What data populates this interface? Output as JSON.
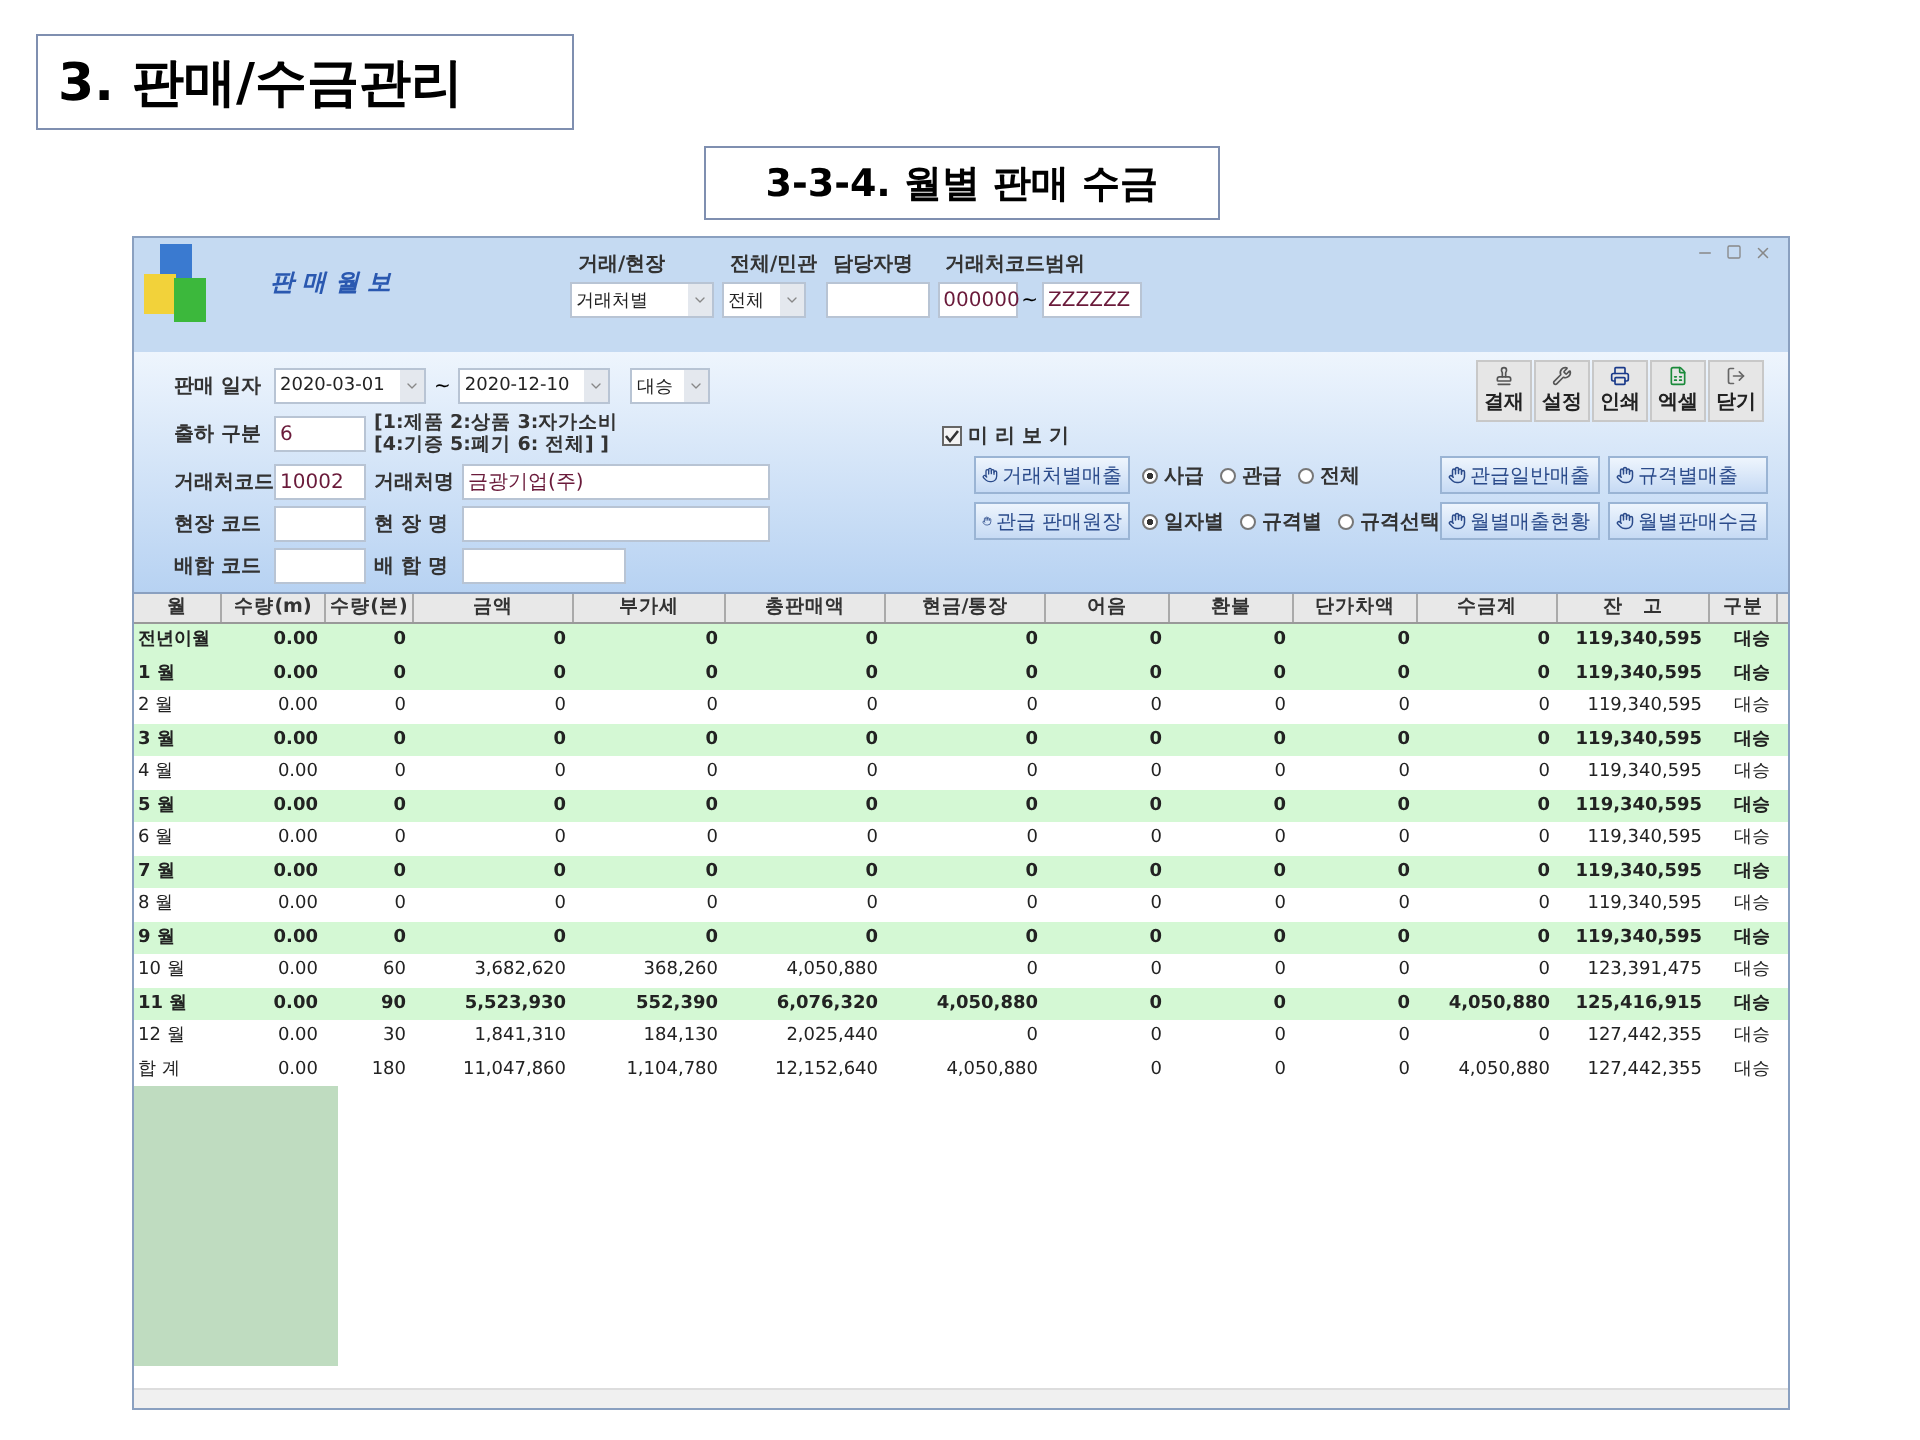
{
  "slide_title": "3. 판매/수금관리",
  "section_title": "3-3-4. 월별 판매 수금",
  "window": {
    "title": "판 매 월 보",
    "filters": [
      {
        "kind": "select",
        "label": "거래/현장",
        "value": "거래처별"
      },
      {
        "kind": "select",
        "label": "전체/민관",
        "value": "전체"
      },
      {
        "kind": "text",
        "label": "담당자명"
      },
      {
        "kind": "range",
        "label": "거래처코드범위",
        "from": "000000",
        "sep": "~",
        "to": "ZZZZZZ"
      }
    ],
    "sale_date": {
      "label": "판매 일자",
      "from": "2020-03-01",
      "sep": "~",
      "to": "2020-12-10",
      "type": "대승"
    },
    "shipment": {
      "label": "출하 구분",
      "value": "6",
      "hint": [
        "[1:제품 2:상품 3:자가소비",
        "[4:기증 5:폐기 6: 전체] ]"
      ]
    },
    "fields": [
      {
        "code_label": "거래처코드",
        "code": "10002",
        "name_label": "거래처명",
        "name": "금광기업(주)"
      },
      {
        "code_label": "현장 코드",
        "name_label": "현 장 명"
      },
      {
        "code_label": "배합 코드",
        "name_label": "배 합 명"
      }
    ],
    "toolbar": [
      {
        "kind": "approve",
        "label": "결재"
      },
      {
        "kind": "settings",
        "label": "설정"
      },
      {
        "kind": "print",
        "label": "인쇄"
      },
      {
        "kind": "excel",
        "label": "엑셀"
      },
      {
        "kind": "exit",
        "label": "닫기"
      }
    ],
    "preview": {
      "label": "미 리 보 기",
      "checked": true
    },
    "report_buttons_left": [
      "거래처별매출",
      "관급 판매원장"
    ],
    "radio_groups": [
      [
        {
          "label": "사급",
          "selected": true
        },
        {
          "label": "관급",
          "selected": false
        },
        {
          "label": "전체",
          "selected": false
        }
      ],
      [
        {
          "label": "일자별",
          "selected": true
        },
        {
          "label": "규격별",
          "selected": false
        },
        {
          "label": "규격선택",
          "selected": false
        }
      ]
    ],
    "report_buttons_right": [
      "관급일반매출",
      "규격별매출",
      "월별매출현황",
      "월별판매수금"
    ],
    "table": {
      "columns": [
        "월",
        "수량(m)",
        "수량(본)",
        "금액",
        "부가세",
        "총판매액",
        "현금/통장",
        "어음",
        "환불",
        "단가차액",
        "수금계",
        "잔　고",
        "구분"
      ],
      "rows": [
        {
          "highlighted": true,
          "cells": [
            "전년이월",
            "0.00",
            "0",
            "0",
            "0",
            "0",
            "0",
            "0",
            "0",
            "0",
            "0",
            "119,340,595",
            "대승"
          ]
        },
        {
          "highlighted": true,
          "cells": [
            "1 월",
            "0.00",
            "0",
            "0",
            "0",
            "0",
            "0",
            "0",
            "0",
            "0",
            "0",
            "119,340,595",
            "대승"
          ]
        },
        {
          "highlighted": false,
          "cells": [
            "2 월",
            "0.00",
            "0",
            "0",
            "0",
            "0",
            "0",
            "0",
            "0",
            "0",
            "0",
            "119,340,595",
            "대승"
          ]
        },
        {
          "highlighted": true,
          "cells": [
            "3 월",
            "0.00",
            "0",
            "0",
            "0",
            "0",
            "0",
            "0",
            "0",
            "0",
            "0",
            "119,340,595",
            "대승"
          ]
        },
        {
          "highlighted": false,
          "cells": [
            "4 월",
            "0.00",
            "0",
            "0",
            "0",
            "0",
            "0",
            "0",
            "0",
            "0",
            "0",
            "119,340,595",
            "대승"
          ]
        },
        {
          "highlighted": true,
          "cells": [
            "5 월",
            "0.00",
            "0",
            "0",
            "0",
            "0",
            "0",
            "0",
            "0",
            "0",
            "0",
            "119,340,595",
            "대승"
          ]
        },
        {
          "highlighted": false,
          "cells": [
            "6 월",
            "0.00",
            "0",
            "0",
            "0",
            "0",
            "0",
            "0",
            "0",
            "0",
            "0",
            "119,340,595",
            "대승"
          ]
        },
        {
          "highlighted": true,
          "cells": [
            "7 월",
            "0.00",
            "0",
            "0",
            "0",
            "0",
            "0",
            "0",
            "0",
            "0",
            "0",
            "119,340,595",
            "대승"
          ]
        },
        {
          "highlighted": false,
          "cells": [
            "8 월",
            "0.00",
            "0",
            "0",
            "0",
            "0",
            "0",
            "0",
            "0",
            "0",
            "0",
            "119,340,595",
            "대승"
          ]
        },
        {
          "highlighted": true,
          "cells": [
            "9 월",
            "0.00",
            "0",
            "0",
            "0",
            "0",
            "0",
            "0",
            "0",
            "0",
            "0",
            "119,340,595",
            "대승"
          ]
        },
        {
          "highlighted": false,
          "cells": [
            "10 월",
            "0.00",
            "60",
            "3,682,620",
            "368,260",
            "4,050,880",
            "0",
            "0",
            "0",
            "0",
            "0",
            "123,391,475",
            "대승"
          ]
        },
        {
          "highlighted": true,
          "cells": [
            "11 월",
            "0.00",
            "90",
            "5,523,930",
            "552,390",
            "6,076,320",
            "4,050,880",
            "0",
            "0",
            "0",
            "4,050,880",
            "125,416,915",
            "대승"
          ]
        },
        {
          "highlighted": false,
          "cells": [
            "12 월",
            "0.00",
            "30",
            "1,841,310",
            "184,130",
            "2,025,440",
            "0",
            "0",
            "0",
            "0",
            "0",
            "127,442,355",
            "대승"
          ]
        },
        {
          "highlighted": false,
          "cells": [
            "합 계",
            "0.00",
            "180",
            "11,047,860",
            "1,104,780",
            "12,152,640",
            "4,050,880",
            "0",
            "0",
            "0",
            "4,050,880",
            "127,442,355",
            "대승"
          ]
        }
      ]
    }
  }
}
